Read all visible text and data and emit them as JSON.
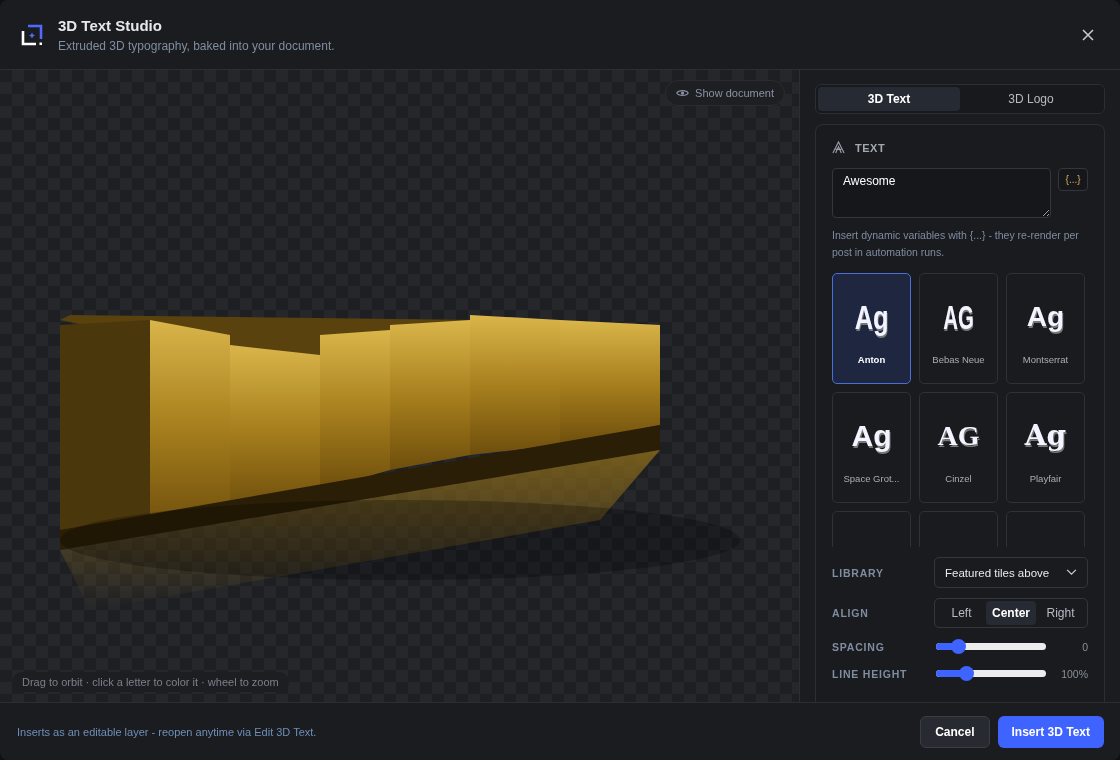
{
  "header": {
    "title": "3D Text Studio",
    "subtitle": "Extruded 3D typography, baked into your document."
  },
  "viewport": {
    "show_document": "Show document",
    "hint": "Drag to orbit · click a letter to color it · wheel to zoom"
  },
  "mode_tabs": [
    {
      "label": "3D Text",
      "selected": true
    },
    {
      "label": "3D Logo",
      "selected": false
    }
  ],
  "text_section": {
    "heading": "TEXT",
    "value": "Awesome",
    "variables_button": "{...}",
    "help": "Insert dynamic variables with {...} - they re-render per post in automation runs."
  },
  "font_tiles": [
    {
      "preview": "Ag",
      "name": "Anton",
      "kind": "condensed",
      "selected": true
    },
    {
      "preview": "AG",
      "name": "Bebas Neue",
      "kind": "caps",
      "selected": false
    },
    {
      "preview": "Ag",
      "name": "Montserrat",
      "kind": "wide",
      "selected": false
    },
    {
      "preview": "Ag",
      "name": "Space Grot...",
      "kind": "sans",
      "selected": false
    },
    {
      "preview": "AG",
      "name": "Cinzel",
      "kind": "serif",
      "selected": false
    },
    {
      "preview": "Ag",
      "name": "Playfair",
      "kind": "display",
      "selected": false
    },
    {
      "kind": "partial",
      "selected": false
    },
    {
      "kind": "partial",
      "selected": false
    },
    {
      "kind": "partial",
      "selected": false
    }
  ],
  "library": {
    "label": "LIBRARY",
    "value": "Featured tiles above"
  },
  "align": {
    "label": "ALIGN",
    "options": [
      {
        "label": "Left",
        "selected": false
      },
      {
        "label": "Center",
        "selected": true
      },
      {
        "label": "Right",
        "selected": false
      }
    ]
  },
  "sliders": [
    {
      "label": "SPACING",
      "level": 0.21,
      "reading": "0"
    },
    {
      "label": "LINE HEIGHT",
      "level": 0.28,
      "reading": "100%"
    }
  ],
  "footer": {
    "note": "Inserts as an editable layer - reopen anytime via Edit 3D Text.",
    "cancel": "Cancel",
    "insert": "Insert 3D Text"
  }
}
